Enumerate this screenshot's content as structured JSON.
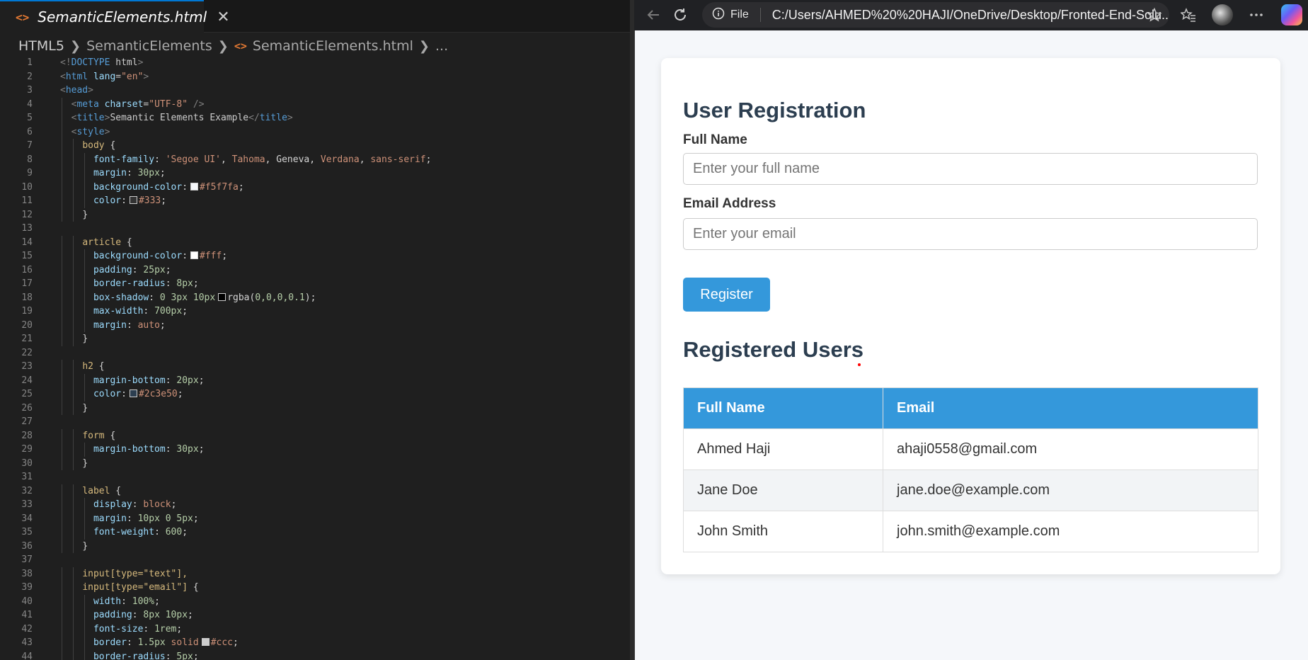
{
  "editor": {
    "tab": {
      "title": "SemanticElements.html",
      "close_glyph": "✕"
    },
    "breadcrumb": {
      "folder": "HTML5",
      "subfolder": "SemanticElements",
      "file": "SemanticElements.html",
      "more": "..."
    },
    "file_glyph": "<>",
    "lines": [
      [
        [
          "punc",
          "<!"
        ],
        [
          "tag",
          "DOCTYPE"
        ],
        [
          "txt",
          " html"
        ],
        [
          "punc",
          ">"
        ]
      ],
      [
        [
          "punc",
          "<"
        ],
        [
          "tag",
          "html"
        ],
        [
          "txt",
          " "
        ],
        [
          "attr",
          "lang"
        ],
        [
          "txt",
          "="
        ],
        [
          "str",
          "\"en\""
        ],
        [
          "punc",
          ">"
        ]
      ],
      [
        [
          "punc",
          "<"
        ],
        [
          "tag",
          "head"
        ],
        [
          "punc",
          ">"
        ]
      ],
      [
        [
          "txt",
          "  "
        ],
        [
          "punc",
          "<"
        ],
        [
          "tag",
          "meta"
        ],
        [
          "txt",
          " "
        ],
        [
          "attr",
          "charset"
        ],
        [
          "txt",
          "="
        ],
        [
          "str",
          "\"UTF-8\""
        ],
        [
          "txt",
          " "
        ],
        [
          "punc",
          "/>"
        ]
      ],
      [
        [
          "txt",
          "  "
        ],
        [
          "punc",
          "<"
        ],
        [
          "tag",
          "title"
        ],
        [
          "punc",
          ">"
        ],
        [
          "txt",
          "Semantic Elements Example"
        ],
        [
          "punc",
          "</"
        ],
        [
          "tag",
          "title"
        ],
        [
          "punc",
          ">"
        ]
      ],
      [
        [
          "txt",
          "  "
        ],
        [
          "punc",
          "<"
        ],
        [
          "tag",
          "style"
        ],
        [
          "punc",
          ">"
        ]
      ],
      [
        [
          "txt",
          "    "
        ],
        [
          "sel",
          "body"
        ],
        [
          "plain",
          " {"
        ]
      ],
      [
        [
          "txt",
          "      "
        ],
        [
          "prop",
          "font-family"
        ],
        [
          "plain",
          ": "
        ],
        [
          "str",
          "'Segoe UI'"
        ],
        [
          "plain",
          ", "
        ],
        [
          "kw",
          "Tahoma"
        ],
        [
          "plain",
          ", Geneva, "
        ],
        [
          "kw",
          "Verdana"
        ],
        [
          "plain",
          ", "
        ],
        [
          "kw",
          "sans-serif"
        ],
        [
          "plain",
          ";"
        ]
      ],
      [
        [
          "txt",
          "      "
        ],
        [
          "prop",
          "margin"
        ],
        [
          "plain",
          ": "
        ],
        [
          "num",
          "30px"
        ],
        [
          "plain",
          ";"
        ]
      ],
      [
        [
          "txt",
          "      "
        ],
        [
          "prop",
          "background-color"
        ],
        [
          "plain",
          ":"
        ],
        [
          "swatch",
          "#f5f7fa"
        ],
        [
          "str",
          "#f5f7fa"
        ],
        [
          "plain",
          ";"
        ]
      ],
      [
        [
          "txt",
          "      "
        ],
        [
          "prop",
          "color"
        ],
        [
          "plain",
          ":"
        ],
        [
          "swatch",
          "#333333"
        ],
        [
          "str",
          "#333"
        ],
        [
          "plain",
          ";"
        ]
      ],
      [
        [
          "txt",
          "    "
        ],
        [
          "plain",
          "}"
        ]
      ],
      [],
      [
        [
          "txt",
          "    "
        ],
        [
          "sel",
          "article"
        ],
        [
          "plain",
          " {"
        ]
      ],
      [
        [
          "txt",
          "      "
        ],
        [
          "prop",
          "background-color"
        ],
        [
          "plain",
          ":"
        ],
        [
          "swatch",
          "#ffffff"
        ],
        [
          "str",
          "#fff"
        ],
        [
          "plain",
          ";"
        ]
      ],
      [
        [
          "txt",
          "      "
        ],
        [
          "prop",
          "padding"
        ],
        [
          "plain",
          ": "
        ],
        [
          "num",
          "25px"
        ],
        [
          "plain",
          ";"
        ]
      ],
      [
        [
          "txt",
          "      "
        ],
        [
          "prop",
          "border-radius"
        ],
        [
          "plain",
          ": "
        ],
        [
          "num",
          "8px"
        ],
        [
          "plain",
          ";"
        ]
      ],
      [
        [
          "txt",
          "      "
        ],
        [
          "prop",
          "box-shadow"
        ],
        [
          "plain",
          ": "
        ],
        [
          "num",
          "0 3px 10px"
        ],
        [
          "swatch",
          "#000000"
        ],
        [
          "plain",
          "rgba("
        ],
        [
          "num",
          "0,0,0,0.1"
        ],
        [
          "plain",
          ");"
        ]
      ],
      [
        [
          "txt",
          "      "
        ],
        [
          "prop",
          "max-width"
        ],
        [
          "plain",
          ": "
        ],
        [
          "num",
          "700px"
        ],
        [
          "plain",
          ";"
        ]
      ],
      [
        [
          "txt",
          "      "
        ],
        [
          "prop",
          "margin"
        ],
        [
          "plain",
          ": "
        ],
        [
          "kw",
          "auto"
        ],
        [
          "plain",
          ";"
        ]
      ],
      [
        [
          "txt",
          "    "
        ],
        [
          "plain",
          "}"
        ]
      ],
      [],
      [
        [
          "txt",
          "    "
        ],
        [
          "sel",
          "h2"
        ],
        [
          "plain",
          " {"
        ]
      ],
      [
        [
          "txt",
          "      "
        ],
        [
          "prop",
          "margin-bottom"
        ],
        [
          "plain",
          ": "
        ],
        [
          "num",
          "20px"
        ],
        [
          "plain",
          ";"
        ]
      ],
      [
        [
          "txt",
          "      "
        ],
        [
          "prop",
          "color"
        ],
        [
          "plain",
          ":"
        ],
        [
          "swatch",
          "#2c3e50"
        ],
        [
          "str",
          "#2c3e50"
        ],
        [
          "plain",
          ";"
        ]
      ],
      [
        [
          "txt",
          "    "
        ],
        [
          "plain",
          "}"
        ]
      ],
      [],
      [
        [
          "txt",
          "    "
        ],
        [
          "sel",
          "form"
        ],
        [
          "plain",
          " {"
        ]
      ],
      [
        [
          "txt",
          "      "
        ],
        [
          "prop",
          "margin-bottom"
        ],
        [
          "plain",
          ": "
        ],
        [
          "num",
          "30px"
        ],
        [
          "plain",
          ";"
        ]
      ],
      [
        [
          "txt",
          "    "
        ],
        [
          "plain",
          "}"
        ]
      ],
      [],
      [
        [
          "txt",
          "    "
        ],
        [
          "sel",
          "label"
        ],
        [
          "plain",
          " {"
        ]
      ],
      [
        [
          "txt",
          "      "
        ],
        [
          "prop",
          "display"
        ],
        [
          "plain",
          ": "
        ],
        [
          "kw",
          "block"
        ],
        [
          "plain",
          ";"
        ]
      ],
      [
        [
          "txt",
          "      "
        ],
        [
          "prop",
          "margin"
        ],
        [
          "plain",
          ": "
        ],
        [
          "num",
          "10px 0 5px"
        ],
        [
          "plain",
          ";"
        ]
      ],
      [
        [
          "txt",
          "      "
        ],
        [
          "prop",
          "font-weight"
        ],
        [
          "plain",
          ": "
        ],
        [
          "num",
          "600"
        ],
        [
          "plain",
          ";"
        ]
      ],
      [
        [
          "txt",
          "    "
        ],
        [
          "plain",
          "}"
        ]
      ],
      [],
      [
        [
          "txt",
          "    "
        ],
        [
          "sel",
          "input[type=\"text\"],"
        ]
      ],
      [
        [
          "txt",
          "    "
        ],
        [
          "sel",
          "input[type=\"email\"]"
        ],
        [
          "plain",
          " {"
        ]
      ],
      [
        [
          "txt",
          "      "
        ],
        [
          "prop",
          "width"
        ],
        [
          "plain",
          ": "
        ],
        [
          "num",
          "100%"
        ],
        [
          "plain",
          ";"
        ]
      ],
      [
        [
          "txt",
          "      "
        ],
        [
          "prop",
          "padding"
        ],
        [
          "plain",
          ": "
        ],
        [
          "num",
          "8px 10px"
        ],
        [
          "plain",
          ";"
        ]
      ],
      [
        [
          "txt",
          "      "
        ],
        [
          "prop",
          "font-size"
        ],
        [
          "plain",
          ": "
        ],
        [
          "num",
          "1rem"
        ],
        [
          "plain",
          ";"
        ]
      ],
      [
        [
          "txt",
          "      "
        ],
        [
          "prop",
          "border"
        ],
        [
          "plain",
          ": "
        ],
        [
          "num",
          "1.5px"
        ],
        [
          "kw",
          " solid"
        ],
        [
          "swatch",
          "#cccccc"
        ],
        [
          "str",
          "#ccc"
        ],
        [
          "plain",
          ";"
        ]
      ],
      [
        [
          "txt",
          "      "
        ],
        [
          "prop",
          "border-radius"
        ],
        [
          "plain",
          ": "
        ],
        [
          "num",
          "5px"
        ],
        [
          "plain",
          ";"
        ]
      ]
    ]
  },
  "browser": {
    "scheme_label": "File",
    "url": "C:/Users/AHMED%20%20HAJI/OneDrive/Desktop/Fronted-End-Solu...",
    "icons": [
      "back-icon",
      "reload-icon",
      "info-icon",
      "favorite-star-icon",
      "favorites-icon",
      "more-icon"
    ]
  },
  "page": {
    "heading": "User Registration",
    "full_name_label": "Full Name",
    "full_name_placeholder": "Enter your full name",
    "email_label": "Email Address",
    "email_placeholder": "Enter your email",
    "register_label": "Register",
    "users_heading": "Registered Users",
    "table": {
      "headers": [
        "Full Name",
        "Email"
      ],
      "rows": [
        [
          "Ahmed Haji",
          "ahaji0558@gmail.com"
        ],
        [
          "Jane Doe",
          "jane.doe@example.com"
        ],
        [
          "John Smith",
          "john.smith@example.com"
        ]
      ]
    },
    "colors": {
      "accent": "#3498db",
      "heading": "#2c3e50",
      "background": "#f5f7fa"
    }
  }
}
